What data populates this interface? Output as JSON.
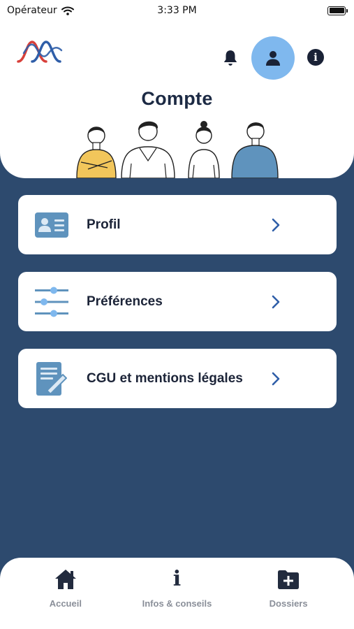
{
  "status_bar": {
    "carrier": "Opérateur",
    "time": "3:33 PM"
  },
  "header": {
    "logo": "waves-logo-icon",
    "title": "Compte",
    "icons": [
      "bell-icon",
      "user-icon",
      "info-icon"
    ],
    "accent_color": "#7fb8ee"
  },
  "menu": {
    "items": [
      {
        "label": "Profil",
        "icon": "id-card-icon"
      },
      {
        "label": "Préférences",
        "icon": "sliders-icon"
      },
      {
        "label": "CGU et mentions légales",
        "icon": "document-pen-icon"
      }
    ]
  },
  "tab_bar": {
    "items": [
      {
        "label": "Accueil",
        "icon": "home-icon"
      },
      {
        "label": "Infos & conseils",
        "icon": "info-i-icon"
      },
      {
        "label": "Dossiers",
        "icon": "folder-plus-icon"
      }
    ]
  },
  "colors": {
    "background": "#2d4a6e",
    "card": "#ffffff",
    "icon_blue": "#5f93bd",
    "title": "#1c2a44"
  }
}
